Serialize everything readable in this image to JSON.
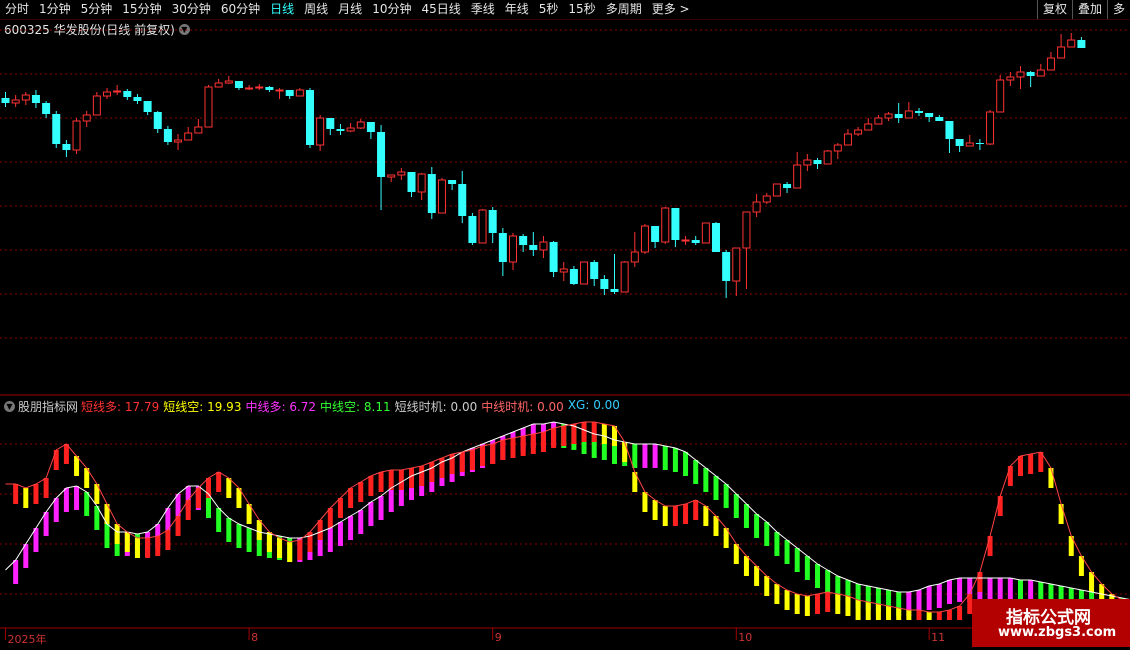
{
  "toolbar": {
    "tabs": [
      {
        "label": "分时",
        "active": false
      },
      {
        "label": "1分钟",
        "active": false
      },
      {
        "label": "5分钟",
        "active": false
      },
      {
        "label": "15分钟",
        "active": false
      },
      {
        "label": "30分钟",
        "active": false
      },
      {
        "label": "60分钟",
        "active": false
      },
      {
        "label": "日线",
        "active": true
      },
      {
        "label": "周线",
        "active": false
      },
      {
        "label": "月线",
        "active": false
      },
      {
        "label": "10分钟",
        "active": false
      },
      {
        "label": "45日线",
        "active": false
      },
      {
        "label": "季线",
        "active": false
      },
      {
        "label": "年线",
        "active": false
      },
      {
        "label": "5秒",
        "active": false
      },
      {
        "label": "15秒",
        "active": false
      },
      {
        "label": "多周期",
        "active": false
      },
      {
        "label": "更多 >",
        "active": false
      }
    ],
    "right_buttons": [
      "复权",
      "叠加",
      "多"
    ]
  },
  "stock": {
    "title": "600325 华发股份(日线 前复权)"
  },
  "indicator": {
    "name": "股朋指标网",
    "values": [
      {
        "label": "短线多:",
        "value": "17.79",
        "color": "#ff3333"
      },
      {
        "label": "短线空:",
        "value": "19.93",
        "color": "#ffff00"
      },
      {
        "label": "中线多:",
        "value": "6.72",
        "color": "#ff33ff"
      },
      {
        "label": "中线空:",
        "value": "8.11",
        "color": "#33ff33"
      },
      {
        "label": "短线时机:",
        "value": "0.00",
        "color": "#cccccc"
      },
      {
        "label": "中线时机:",
        "value": "0.00",
        "color": "#ff6666"
      },
      {
        "label": "XG:",
        "value": "0.00",
        "color": "#33ccff"
      }
    ]
  },
  "xaxis": {
    "labels": [
      {
        "text": "2025年",
        "bar": 0
      },
      {
        "text": "8",
        "bar": 24
      },
      {
        "text": "9",
        "bar": 48
      },
      {
        "text": "10",
        "bar": 72
      },
      {
        "text": "11",
        "bar": 91
      }
    ]
  },
  "watermark": {
    "line1": "指标公式网",
    "line2": "www.zbgs3.com"
  },
  "colors": {
    "up": "#ff3333",
    "down": "#33ffff",
    "grid": "#8b0000",
    "short_bull": "#ff2020",
    "short_bear": "#ffff00",
    "mid_bull": "#ff22ff",
    "mid_bear": "#22ff22"
  },
  "chart_data": [
    {
      "type": "candlestick",
      "ohlc": [
        [
          242,
          237,
          233,
          248
        ],
        [
          237,
          240,
          233,
          245
        ],
        [
          240,
          245,
          235,
          248
        ],
        [
          245,
          237,
          232,
          250
        ],
        [
          237,
          226,
          222,
          239
        ],
        [
          226,
          196,
          192,
          229
        ],
        [
          196,
          190,
          183,
          200
        ],
        [
          190,
          219,
          186,
          222
        ],
        [
          219,
          225,
          213,
          229
        ],
        [
          225,
          244,
          238,
          248
        ],
        [
          244,
          248,
          241,
          252
        ],
        [
          248,
          249,
          245,
          255
        ],
        [
          249,
          243,
          240,
          251
        ],
        [
          243,
          239,
          236,
          246
        ],
        [
          239,
          228,
          225,
          239
        ],
        [
          228,
          211,
          207,
          229
        ],
        [
          211,
          198,
          195,
          214
        ],
        [
          198,
          200,
          190,
          206
        ],
        [
          200,
          207,
          204,
          213
        ],
        [
          207,
          213,
          209,
          221
        ],
        [
          213,
          253,
          248,
          255
        ],
        [
          253,
          257,
          254,
          261
        ],
        [
          257,
          259,
          256,
          264
        ],
        [
          259,
          252,
          250,
          255
        ],
        [
          252,
          252,
          250,
          255
        ],
        [
          252,
          253,
          250,
          256
        ],
        [
          253,
          250,
          248,
          254
        ],
        [
          250,
          250,
          241,
          252
        ],
        [
          250,
          244,
          241,
          247
        ],
        [
          244,
          250,
          244,
          252
        ],
        [
          250,
          195,
          192,
          252
        ],
        [
          195,
          222,
          189,
          225
        ],
        [
          222,
          211,
          205,
          215
        ],
        [
          211,
          209,
          205,
          216
        ],
        [
          209,
          212,
          208,
          217
        ],
        [
          212,
          218,
          211,
          221
        ],
        [
          218,
          208,
          201,
          211
        ],
        [
          208,
          163,
          130,
          215
        ],
        [
          163,
          165,
          158,
          162
        ],
        [
          165,
          168,
          160,
          172
        ],
        [
          168,
          148,
          143,
          150
        ],
        [
          148,
          166,
          140,
          167
        ],
        [
          166,
          127,
          121,
          173
        ],
        [
          127,
          160,
          130,
          162
        ],
        [
          160,
          156,
          150,
          155
        ],
        [
          156,
          124,
          117,
          169
        ],
        [
          124,
          97,
          95,
          127
        ],
        [
          97,
          130,
          104,
          131
        ],
        [
          130,
          107,
          97,
          133
        ],
        [
          107,
          78,
          64,
          112
        ],
        [
          78,
          104,
          70,
          107
        ],
        [
          104,
          95,
          88,
          106
        ],
        [
          95,
          90,
          84,
          108
        ],
        [
          90,
          98,
          82,
          104
        ],
        [
          98,
          68,
          63,
          99
        ],
        [
          68,
          71,
          59,
          78
        ],
        [
          71,
          56,
          55,
          74
        ],
        [
          56,
          78,
          67,
          72
        ],
        [
          78,
          61,
          54,
          80
        ],
        [
          61,
          51,
          45,
          65
        ],
        [
          51,
          48,
          46,
          86
        ],
        [
          48,
          78,
          55,
          79
        ],
        [
          78,
          88,
          73,
          108
        ],
        [
          88,
          114,
          86,
          116
        ],
        [
          114,
          98,
          92,
          110
        ],
        [
          98,
          132,
          96,
          133
        ],
        [
          132,
          100,
          93,
          121
        ],
        [
          100,
          100,
          95,
          104
        ],
        [
          100,
          97,
          95,
          104
        ],
        [
          97,
          117,
          99,
          112
        ],
        [
          117,
          88,
          89,
          118
        ],
        [
          88,
          59,
          42,
          90
        ],
        [
          59,
          92,
          44,
          87
        ],
        [
          92,
          128,
          51,
          125
        ],
        [
          128,
          138,
          123,
          146
        ],
        [
          138,
          144,
          136,
          147
        ],
        [
          144,
          156,
          145,
          153
        ],
        [
          156,
          152,
          147,
          158
        ],
        [
          152,
          175,
          160,
          188
        ],
        [
          175,
          180,
          169,
          186
        ],
        [
          180,
          176,
          171,
          182
        ],
        [
          176,
          189,
          177,
          190
        ],
        [
          189,
          195,
          181,
          197
        ],
        [
          195,
          206,
          199,
          211
        ],
        [
          206,
          210,
          204,
          213
        ],
        [
          210,
          216,
          211,
          222
        ],
        [
          216,
          222,
          220,
          225
        ],
        [
          222,
          226,
          219,
          228
        ],
        [
          226,
          222,
          217,
          237
        ],
        [
          222,
          229,
          227,
          238
        ],
        [
          229,
          227,
          224,
          232
        ],
        [
          227,
          223,
          218,
          225
        ],
        [
          223,
          219,
          220,
          225
        ],
        [
          219,
          201,
          187,
          203
        ],
        [
          201,
          194,
          188,
          195
        ],
        [
          194,
          197,
          195,
          205
        ],
        [
          197,
          196,
          190,
          201
        ],
        [
          196,
          228,
          195,
          230
        ],
        [
          228,
          260,
          254,
          265
        ],
        [
          260,
          263,
          254,
          268
        ],
        [
          263,
          268,
          251,
          274
        ],
        [
          268,
          264,
          253,
          269
        ],
        [
          264,
          270,
          266,
          276
        ],
        [
          270,
          282,
          276,
          288
        ],
        [
          282,
          293,
          296,
          306
        ],
        [
          293,
          300,
          298,
          307
        ],
        [
          300,
          292,
          294,
          303
        ]
      ]
    },
    {
      "type": "indicator",
      "series": [
        {
          "name": "短线",
          "values": [
            68,
            68,
            66,
            68,
            71,
            85,
            88,
            82,
            76,
            68,
            58,
            48,
            44,
            41,
            41,
            42,
            45,
            52,
            60,
            66,
            71,
            74,
            71,
            66,
            58,
            50,
            44,
            41,
            39,
            40,
            44,
            50,
            56,
            61,
            66,
            69,
            72,
            74,
            75,
            75,
            76,
            77,
            79,
            81,
            83,
            84,
            85,
            87,
            88,
            90,
            91,
            92,
            93,
            94,
            96,
            97,
            98,
            99,
            99,
            98,
            97,
            89,
            74,
            64,
            60,
            57,
            57,
            58,
            60,
            57,
            52,
            46,
            38,
            32,
            27,
            22,
            18,
            15,
            13,
            12,
            13,
            14,
            13,
            12,
            10,
            9,
            8,
            7,
            6,
            5,
            5,
            4,
            4,
            5,
            7,
            13,
            24,
            42,
            62,
            77,
            82,
            83,
            84,
            76,
            58,
            42,
            32,
            24,
            18,
            13,
            10,
            9
          ]
        },
        {
          "name": "中线",
          "values": [
            25,
            30,
            38,
            46,
            54,
            61,
            66,
            67,
            64,
            57,
            48,
            44,
            44,
            43,
            44,
            48,
            56,
            63,
            67,
            67,
            63,
            56,
            51,
            48,
            46,
            44,
            43,
            42,
            41,
            41,
            42,
            44,
            46,
            49,
            52,
            55,
            59,
            62,
            66,
            69,
            72,
            74,
            76,
            79,
            81,
            84,
            86,
            88,
            90,
            92,
            94,
            96,
            98,
            98,
            99,
            98,
            97,
            95,
            93,
            92,
            90,
            89,
            88,
            88,
            88,
            87,
            86,
            84,
            80,
            76,
            72,
            68,
            63,
            58,
            53,
            49,
            44,
            40,
            36,
            32,
            28,
            25,
            22,
            20,
            18,
            17,
            16,
            15,
            14,
            14,
            15,
            17,
            18,
            20,
            21,
            21,
            21,
            21,
            21,
            21,
            20,
            20,
            19,
            18,
            17,
            16,
            15,
            14,
            13,
            12,
            11,
            10
          ]
        }
      ]
    }
  ]
}
